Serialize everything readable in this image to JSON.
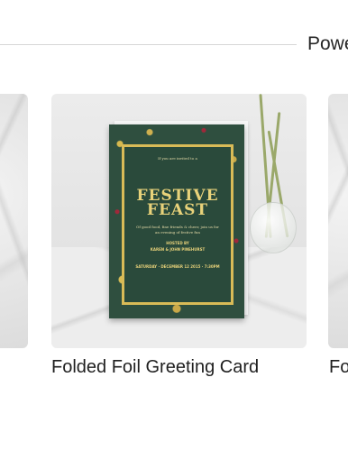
{
  "header": {
    "powered_label": "Powe"
  },
  "products": {
    "main": {
      "title": "Folded Foil Greeting Card",
      "invite": {
        "intro": "If you are invited to a",
        "title_line1": "FESTIVE",
        "title_line2": "FEAST",
        "body": "Of good food, fine friends & cheer, join us for an evening of festive fun",
        "hosted_by": "HOSTED BY",
        "hosts": "KAREN & JOHN PINEHURST",
        "date_line": "SATURDAY · DECEMBER 12 2015 · 7:30PM"
      }
    },
    "right": {
      "title_partial": "Fo"
    }
  },
  "colors": {
    "card_green": "#2f4f3f",
    "gold_foil": "#d9bb57",
    "berry_red": "#a0283a"
  }
}
